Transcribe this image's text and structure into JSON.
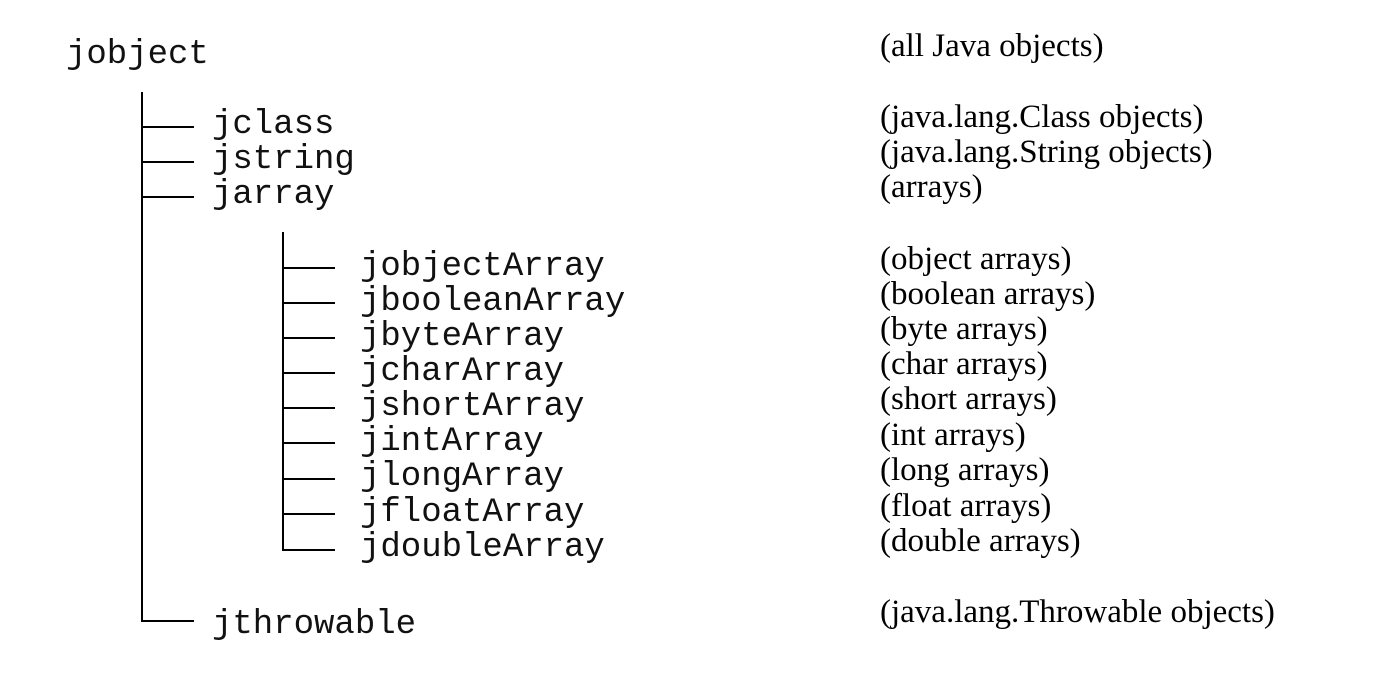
{
  "root": {
    "label": "jobject",
    "description": "(all Java objects)"
  },
  "children": [
    {
      "label": "jclass",
      "description": "(java.lang.Class objects)"
    },
    {
      "label": "jstring",
      "description": "(java.lang.String objects)"
    },
    {
      "label": "jarray",
      "description": "(arrays)"
    },
    {
      "label": "jthrowable",
      "description": "(java.lang.Throwable objects)"
    }
  ],
  "array_types": [
    {
      "label": "jobjectArray",
      "description": "(object arrays)"
    },
    {
      "label": "jbooleanArray",
      "description": "(boolean arrays)"
    },
    {
      "label": "jbyteArray",
      "description": "(byte arrays)"
    },
    {
      "label": "jcharArray",
      "description": "(char arrays)"
    },
    {
      "label": "jshortArray",
      "description": "(short arrays)"
    },
    {
      "label": "jintArray",
      "description": "(int arrays)"
    },
    {
      "label": "jlongArray",
      "description": "(long arrays)"
    },
    {
      "label": "jfloatArray",
      "description": "(float arrays)"
    },
    {
      "label": "jdoubleArray",
      "description": "(double arrays)"
    }
  ]
}
